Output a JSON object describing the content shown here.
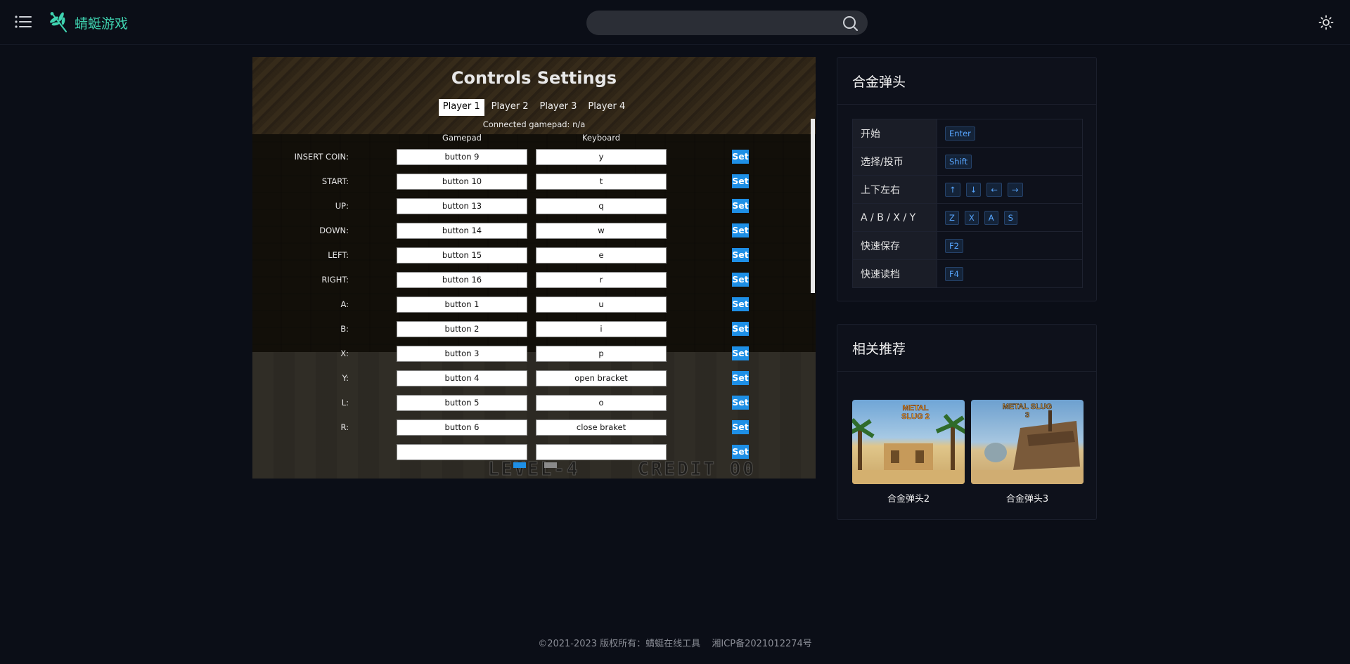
{
  "header": {
    "logo_text": "蜻蜓游戏",
    "search_placeholder": ""
  },
  "game": {
    "title": "Controls Settings",
    "tabs": [
      "Player 1",
      "Player 2",
      "Player 3",
      "Player 4"
    ],
    "active_tab": "Player 1",
    "gamepad_status": "Connected gamepad: n/a",
    "col_gamepad": "Gamepad",
    "col_keyboard": "Keyboard",
    "set_label": "Set",
    "hud_level": "LEVEL-4",
    "hud_credit": "CREDIT 00",
    "rows": [
      {
        "label": "INSERT COIN:",
        "gamepad": "button 9",
        "keyboard": "y"
      },
      {
        "label": "START:",
        "gamepad": "button 10",
        "keyboard": "t"
      },
      {
        "label": "UP:",
        "gamepad": "button 13",
        "keyboard": "q"
      },
      {
        "label": "DOWN:",
        "gamepad": "button 14",
        "keyboard": "w"
      },
      {
        "label": "LEFT:",
        "gamepad": "button 15",
        "keyboard": "e"
      },
      {
        "label": "RIGHT:",
        "gamepad": "button 16",
        "keyboard": "r"
      },
      {
        "label": "A:",
        "gamepad": "button 1",
        "keyboard": "u"
      },
      {
        "label": "B:",
        "gamepad": "button 2",
        "keyboard": "i"
      },
      {
        "label": "X:",
        "gamepad": "button 3",
        "keyboard": "p"
      },
      {
        "label": "Y:",
        "gamepad": "button 4",
        "keyboard": "open bracket"
      },
      {
        "label": "L:",
        "gamepad": "button 5",
        "keyboard": "o"
      },
      {
        "label": "R:",
        "gamepad": "button 6",
        "keyboard": "close braket"
      },
      {
        "label": "",
        "gamepad": "",
        "keyboard": ""
      }
    ],
    "colors": {
      "set_button": "#1e8fe6"
    }
  },
  "controls_panel": {
    "title": "合金弹头",
    "rows": [
      {
        "name": "开始",
        "keys": [
          "Enter"
        ]
      },
      {
        "name": "选择/投币",
        "keys": [
          "Shift"
        ]
      },
      {
        "name": "上下左右",
        "keys": [
          "↑",
          "↓",
          "←",
          "→"
        ]
      },
      {
        "name": "A / B / X / Y",
        "keys": [
          "Z",
          "X",
          "A",
          "S"
        ]
      },
      {
        "name": "快速保存",
        "keys": [
          "F2"
        ]
      },
      {
        "name": "快速读档",
        "keys": [
          "F4"
        ]
      }
    ]
  },
  "recommend_panel": {
    "title": "相关推荐",
    "items": [
      {
        "name": "合金弹头2",
        "thumb_label": "METAL SLUG 2",
        "accent": "#e8b542"
      },
      {
        "name": "合金弹头3",
        "thumb_label": "METAL SLUG 3",
        "accent": "#c9a35e"
      }
    ]
  },
  "footer": {
    "copyright": "©2021-2023 版权所有：蜻蜓在线工具",
    "icp": "湘ICP备2021012274号"
  },
  "colors": {
    "background": "#0b0e17",
    "accent": "#3fd3b0",
    "key_text": "#58a6ff"
  }
}
